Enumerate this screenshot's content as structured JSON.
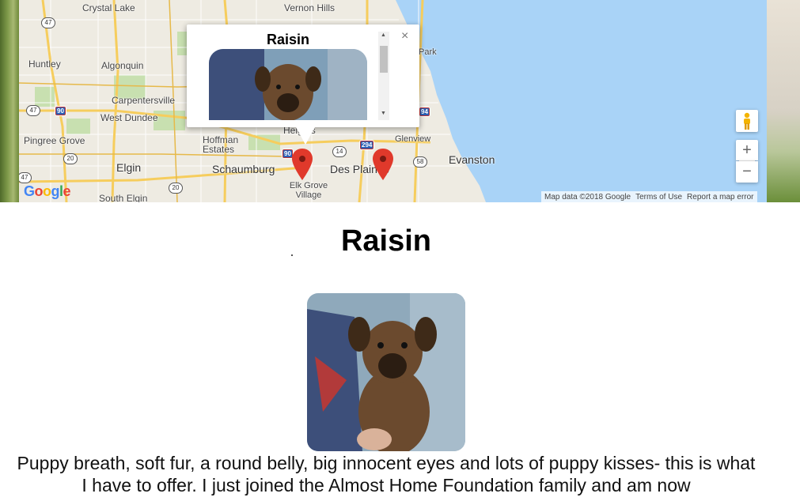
{
  "map": {
    "places": {
      "crystal_lake": "Crystal Lake",
      "vernon_hills": "Vernon Hills",
      "park": "Park",
      "huntley": "Huntley",
      "algonquin": "Algonquin",
      "carpentersville": "Carpentersville",
      "west_dundee": "West Dundee",
      "pingree_grove": "Pingree Grove",
      "hoffman_estates": "Hoffman Estates",
      "heights": "Heights",
      "glenview": "Glenview",
      "evanston": "Evanston",
      "elgin": "Elgin",
      "schaumburg": "Schaumburg",
      "des_plaines": "Des Plaines",
      "elk_grove_village": "Elk Grove Village",
      "south_elgin": "South Elgin"
    },
    "highways": {
      "h47a": "47",
      "h90a": "90",
      "h47b": "47",
      "h294": "294",
      "h90b": "90",
      "h94": "94",
      "h20a": "20",
      "h14": "14",
      "h58": "58",
      "h47c": "47",
      "h20b": "20"
    },
    "google_logo": "Google",
    "attribution": {
      "map_data": "Map data ©2018 Google",
      "terms": "Terms of Use",
      "report": "Report a map error"
    },
    "controls": {
      "zoom_in": "+",
      "zoom_out": "−"
    },
    "colors": {
      "water": "#a9d3f7",
      "land": "#eeebe2",
      "park": "#c8e0b0",
      "highway": "#f6cd5d",
      "marker": "#e0392b"
    }
  },
  "info_window": {
    "title": "Raisin",
    "close": "×",
    "scroll_up": "▲",
    "scroll_down": "▼"
  },
  "pet": {
    "name": "Raisin",
    "description": "Puppy breath, soft fur, a round belly, big innocent eyes and lots of puppy kisses- this is what I have to offer. I just joined the Almost Home Foundation family and am now"
  }
}
